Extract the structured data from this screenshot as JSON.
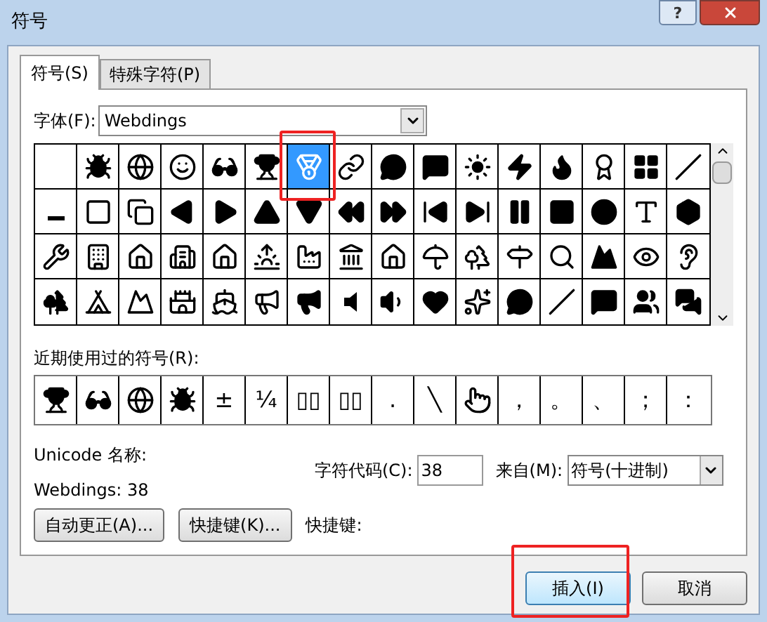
{
  "window": {
    "title": "符号",
    "help_button": "?"
  },
  "tabs": [
    {
      "label": "符号(S)",
      "selected": true
    },
    {
      "label": "特殊字符(P)",
      "selected": false
    }
  ],
  "font": {
    "label": "字体(F):",
    "value": "Webdings"
  },
  "symbol_grid": {
    "cells": [
      {
        "selected": false,
        "highlighted": false
      },
      {
        "selected": false,
        "highlighted": false
      },
      {
        "selected": false,
        "highlighted": false
      },
      {
        "selected": false,
        "highlighted": false
      },
      {
        "selected": false,
        "highlighted": false
      },
      {
        "selected": false,
        "highlighted": false
      },
      {
        "selected": true,
        "highlighted": true
      },
      {
        "selected": false,
        "highlighted": false
      },
      {
        "selected": false,
        "highlighted": false
      },
      {
        "selected": false,
        "highlighted": false
      },
      {
        "selected": false,
        "highlighted": false
      },
      {
        "selected": false,
        "highlighted": false
      },
      {
        "selected": false,
        "highlighted": false
      },
      {
        "selected": false,
        "highlighted": false
      },
      {
        "selected": false,
        "highlighted": false
      },
      {
        "selected": false,
        "highlighted": false
      },
      {
        "selected": false,
        "highlighted": false
      },
      {
        "selected": false,
        "highlighted": false
      },
      {
        "selected": false,
        "highlighted": false
      },
      {
        "selected": false,
        "highlighted": false
      },
      {
        "selected": false,
        "highlighted": false
      },
      {
        "selected": false,
        "highlighted": false
      },
      {
        "selected": false,
        "highlighted": false
      },
      {
        "selected": false,
        "highlighted": false
      },
      {
        "selected": false,
        "highlighted": false
      },
      {
        "selected": false,
        "highlighted": false
      },
      {
        "selected": false,
        "highlighted": false
      },
      {
        "selected": false,
        "highlighted": false
      },
      {
        "selected": false,
        "highlighted": false
      },
      {
        "selected": false,
        "highlighted": false
      },
      {
        "selected": false,
        "highlighted": false
      },
      {
        "selected": false,
        "highlighted": false
      },
      {
        "selected": false,
        "highlighted": false
      },
      {
        "selected": false,
        "highlighted": false
      },
      {
        "selected": false,
        "highlighted": false
      },
      {
        "selected": false,
        "highlighted": false
      },
      {
        "selected": false,
        "highlighted": false
      },
      {
        "selected": false,
        "highlighted": false
      },
      {
        "selected": false,
        "highlighted": false
      },
      {
        "selected": false,
        "highlighted": false
      },
      {
        "selected": false,
        "highlighted": false
      },
      {
        "selected": false,
        "highlighted": false
      },
      {
        "selected": false,
        "highlighted": false
      },
      {
        "selected": false,
        "highlighted": false
      },
      {
        "selected": false,
        "highlighted": false
      },
      {
        "selected": false,
        "highlighted": false
      },
      {
        "selected": false,
        "highlighted": false
      },
      {
        "selected": false,
        "highlighted": false
      },
      {
        "selected": false,
        "highlighted": false
      },
      {
        "selected": false,
        "highlighted": false
      },
      {
        "selected": false,
        "highlighted": false
      },
      {
        "selected": false,
        "highlighted": false
      },
      {
        "selected": false,
        "highlighted": false
      },
      {
        "selected": false,
        "highlighted": false
      },
      {
        "selected": false,
        "highlighted": false
      },
      {
        "selected": false,
        "highlighted": false
      },
      {
        "selected": false,
        "highlighted": false
      },
      {
        "selected": false,
        "highlighted": false
      },
      {
        "selected": false,
        "highlighted": false
      },
      {
        "selected": false,
        "highlighted": false
      },
      {
        "selected": false,
        "highlighted": false
      },
      {
        "selected": false,
        "highlighted": false
      },
      {
        "selected": false,
        "highlighted": false
      },
      {
        "selected": false,
        "highlighted": false
      }
    ]
  },
  "recent": {
    "label": "近期使用过的符号(R):",
    "items": [
      {
        "kind": "icon"
      },
      {
        "kind": "icon"
      },
      {
        "kind": "icon"
      },
      {
        "kind": "icon"
      },
      {
        "kind": "text",
        "text": "±"
      },
      {
        "kind": "text",
        "text": "¼"
      },
      {
        "kind": "text",
        "text": "▯▯"
      },
      {
        "kind": "text",
        "text": "▯▯"
      },
      {
        "kind": "text",
        "text": "."
      },
      {
        "kind": "text",
        "text": "╲"
      },
      {
        "kind": "icon"
      },
      {
        "kind": "text",
        "text": "，"
      },
      {
        "kind": "text",
        "text": "。"
      },
      {
        "kind": "text",
        "text": "、"
      },
      {
        "kind": "text",
        "text": "；"
      },
      {
        "kind": "text",
        "text": "："
      }
    ]
  },
  "unicode_name": "Unicode 名称:",
  "symbol_info": "Webdings: 38",
  "char_code": {
    "label": "字符代码(C):",
    "value": "38"
  },
  "from": {
    "label": "来自(M):",
    "value": "符号(十进制)"
  },
  "buttons": [
    {
      "label": "自动更正(A)..."
    },
    {
      "label": "快捷键(K)..."
    }
  ],
  "shortcut_label": "快捷键:",
  "footer_buttons": [
    {
      "label": "插入(I)",
      "highlighted": true,
      "default": true
    },
    {
      "label": "取消",
      "highlighted": false,
      "default": false
    }
  ]
}
